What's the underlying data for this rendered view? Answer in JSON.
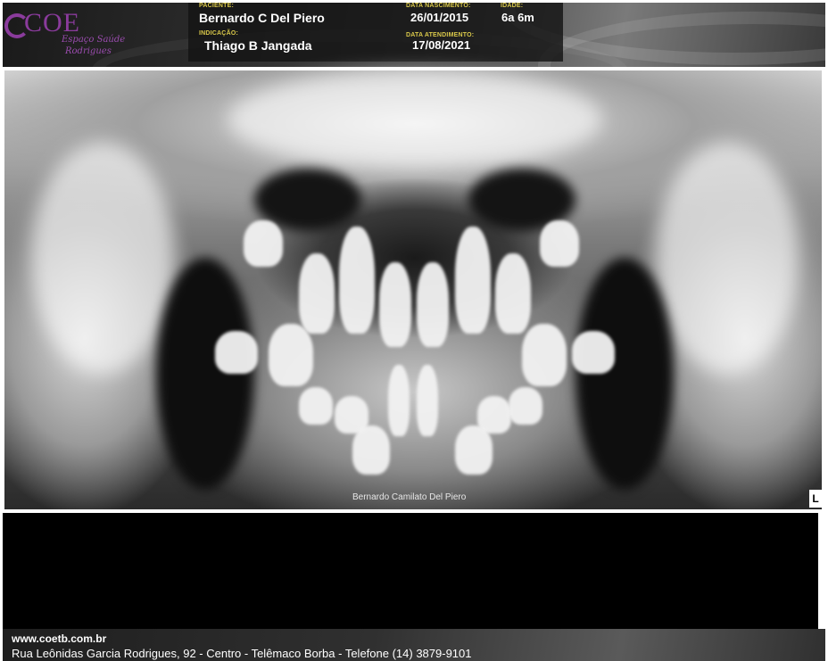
{
  "header": {
    "logo": {
      "name": "COE",
      "tagline_1": "Espaço Saúde",
      "tagline_2": "Rodrigues"
    },
    "patient_label": "PACIENTE:",
    "patient_name": "Bernardo C Del Piero",
    "birth_label": "DATA NASCIMENTO:",
    "birth_date": "26/01/2015",
    "age_label": "IDADE:",
    "age": "6a 6m",
    "referral_label": "INDICAÇÃO:",
    "referral_name": "Thiago B Jangada",
    "attendance_label": "DATA ATENDIMENTO:",
    "attendance_date": "17/08/2021"
  },
  "xray": {
    "caption": "Bernardo Camilato Del Piero",
    "side_marker": "L"
  },
  "footer": {
    "website": "www.coetb.com.br",
    "address": "Rua Leônidas Garcia Rodrigues, 92 - Centro - Telêmaco Borba  -  Telefone (14) 3879-9101"
  },
  "colors": {
    "label_yellow": "#d9c84a",
    "logo_purple": "#8a3b9c"
  }
}
